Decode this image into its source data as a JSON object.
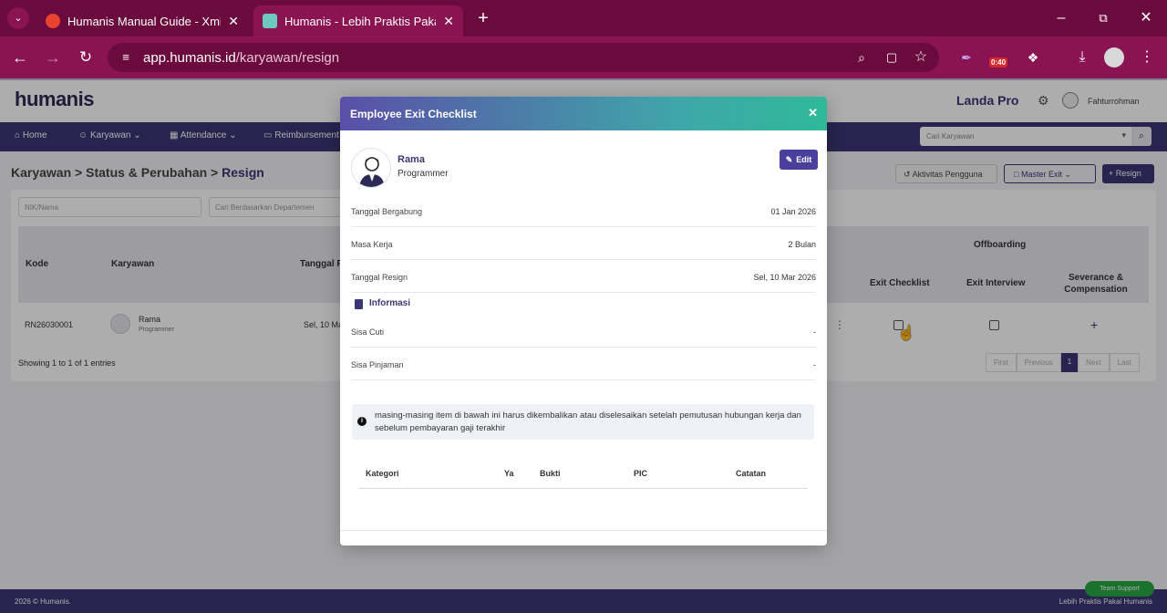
{
  "browser": {
    "tabs": [
      {
        "title": "Humanis Manual Guide - Xmind",
        "active": false
      },
      {
        "title": "Humanis - Lebih Praktis Pakai Humanis",
        "active": true
      }
    ],
    "url_host": "app.humanis.id",
    "url_path": "/karyawan/resign",
    "timer_badge": "0:40"
  },
  "app": {
    "logo": "humanis",
    "company": "Landa Pro",
    "user": "Fahturrohman",
    "search_placeholder": "Cari Karyawan",
    "nav": [
      "Home",
      "Karyawan",
      "Attendance",
      "Reimbursement"
    ],
    "breadcrumb": {
      "p1": "Karyawan",
      "p2": "Status & Perubahan",
      "p3": "Resign"
    },
    "buttons": {
      "activity": "Aktivitas Pengguna",
      "master_exit": "Master Exit",
      "resign": "Resign"
    },
    "filters": {
      "nik": "NIK/Nama",
      "dept": "Cari Berdasarkan Departemen"
    },
    "table": {
      "headers": {
        "kode": "Kode",
        "karyawan": "Karyawan",
        "tanggal": "Tanggal R",
        "offboarding": "Offboarding",
        "exit_checklist": "Exit Checklist",
        "exit_interview": "Exit Interview",
        "severance": "Severance & Compensation"
      },
      "row": {
        "kode": "RN26030001",
        "name": "Rama",
        "position": "Programmer",
        "tanggal": "Sel, 10 Ma"
      }
    },
    "entries": "Showing 1 to 1 of 1 entries",
    "pagination": [
      "First",
      "Previous",
      "1",
      "Next",
      "Last"
    ],
    "footer_left": "2026 © Humanis.",
    "footer_right": "Lebih Praktis Pakai Humanis",
    "support": "Team Support"
  },
  "modal": {
    "title": "Employee Exit Checklist",
    "name": "Rama",
    "position": "Programmer",
    "edit_label": "Edit",
    "details": [
      {
        "label": "Tanggal Bergabung",
        "value": "01 Jan 2026"
      },
      {
        "label": "Masa Kerja",
        "value": "2 Bulan"
      },
      {
        "label": "Tanggal Resign",
        "value": "Sel, 10 Mar 2026"
      }
    ],
    "info_title": "Informasi",
    "info": [
      {
        "label": "Sisa Cuti",
        "value": "-"
      },
      {
        "label": "Sisa Pinjaman",
        "value": "-"
      }
    ],
    "alert": "masing-masing item di bawah ini harus dikembalikan atau diselesaikan setelah pemutusan hubungan kerja dan sebelum pembayaran gaji terakhir",
    "checklist_headers": {
      "kategori": "Kategori",
      "ya": "Ya",
      "bukti": "Bukti",
      "pic": "PIC",
      "catatan": "Catatan"
    }
  }
}
